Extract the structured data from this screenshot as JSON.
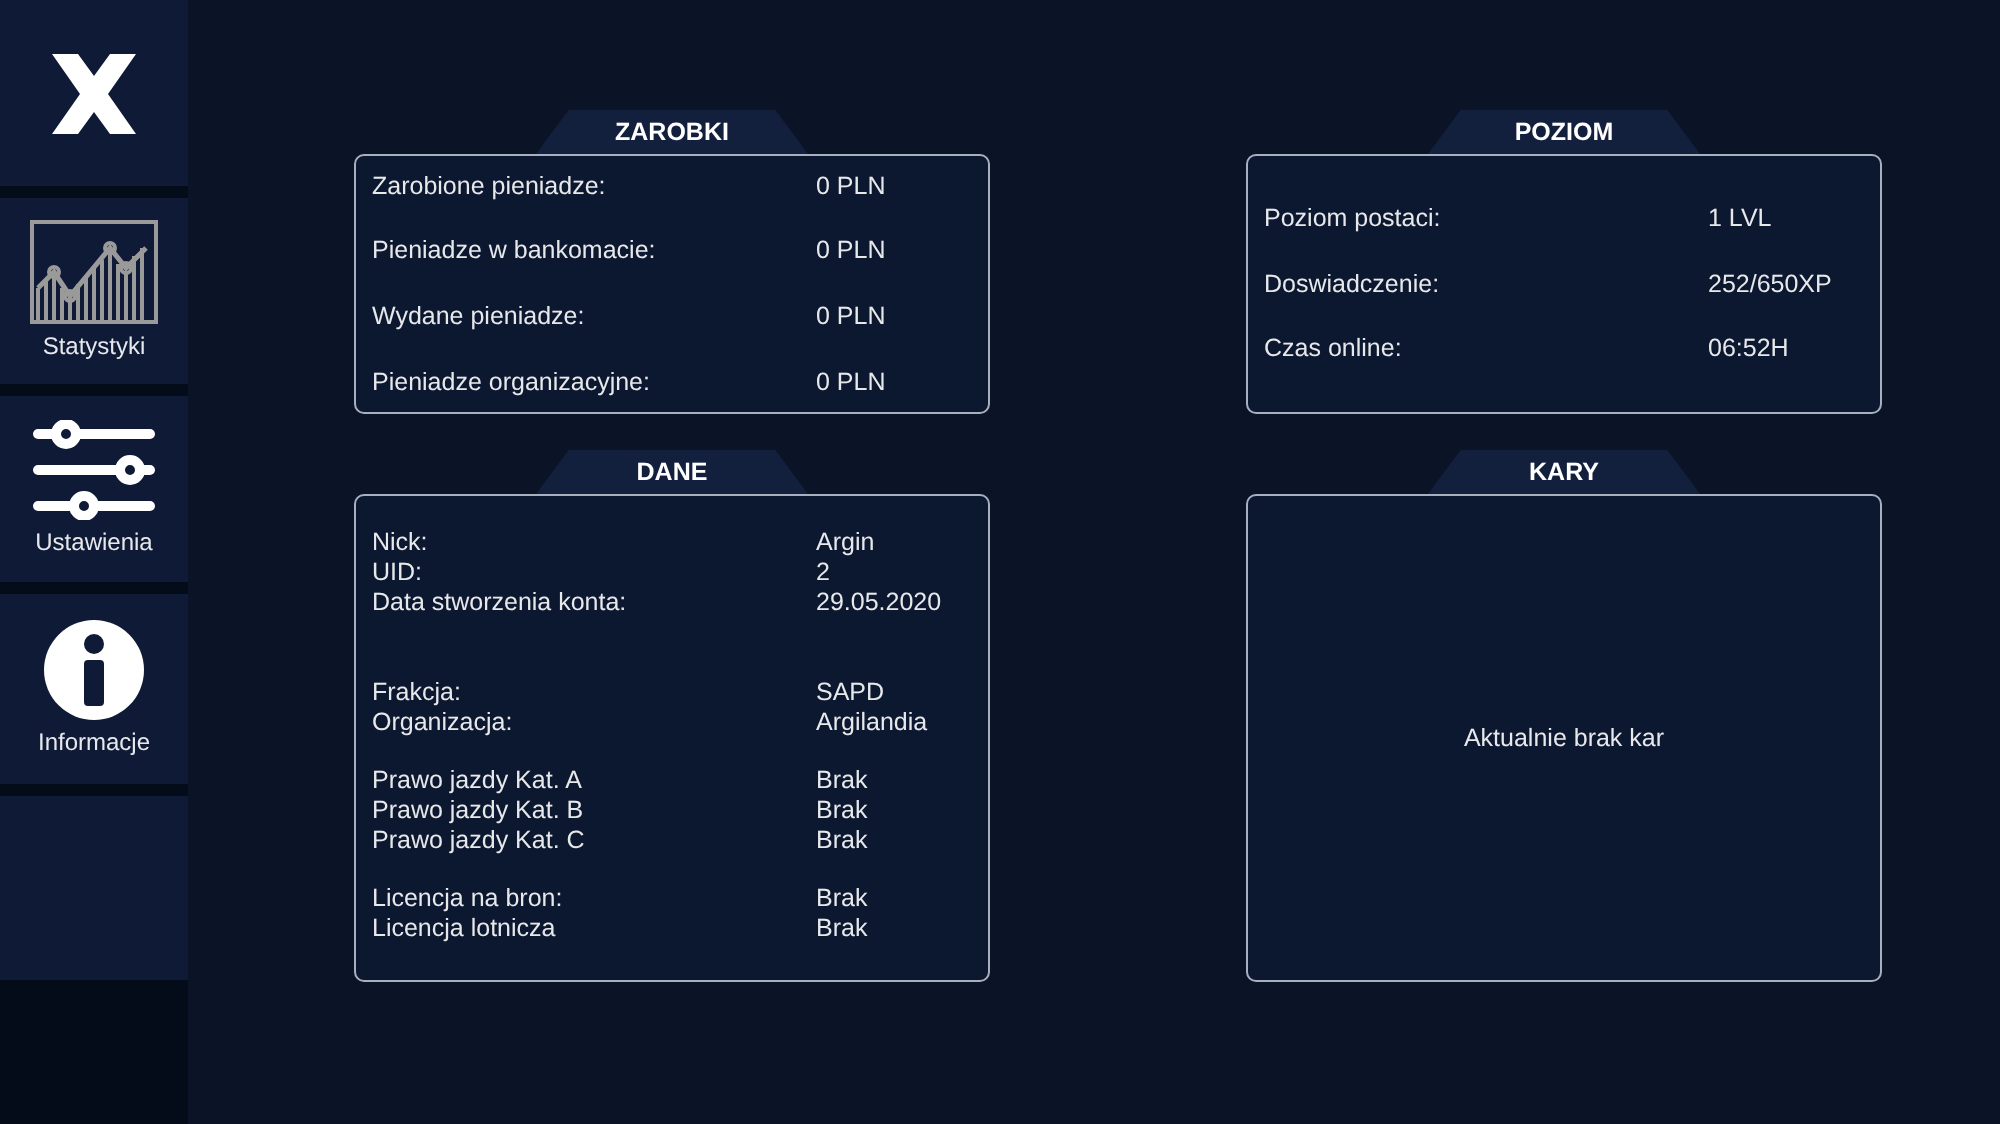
{
  "sidebar": {
    "items": [
      {
        "kind": "close"
      },
      {
        "kind": "stats",
        "label": "Statystyki"
      },
      {
        "kind": "settings",
        "label": "Ustawienia"
      },
      {
        "kind": "info",
        "label": "Informacje"
      }
    ]
  },
  "panels": [
    {
      "title": "ZAROBKI",
      "kind": "list",
      "rows": [
        {
          "label": "Zarobione pieniadze:",
          "value": "0 PLN"
        },
        {
          "label": "Pieniadze w bankomacie:",
          "value": "0 PLN"
        },
        {
          "label": "Wydane pieniadze:",
          "value": "0 PLN"
        },
        {
          "label": "Pieniadze organizacyjne:",
          "value": "0 PLN"
        }
      ]
    },
    {
      "title": "POZIOM",
      "kind": "list",
      "rows": [
        {
          "label": "Poziom postaci:",
          "value": "1 LVL"
        },
        {
          "label": "Doswiadczenie:",
          "value": "252/650XP"
        },
        {
          "label": "Czas online:",
          "value": "06:52H"
        }
      ]
    },
    {
      "title": "DANE",
      "kind": "groups",
      "groups": [
        [
          {
            "label": "Nick:",
            "value": "Argin"
          },
          {
            "label": "UID:",
            "value": "2"
          },
          {
            "label": "Data stworzenia konta:",
            "value": "29.05.2020"
          }
        ],
        [
          {
            "label": "Frakcja:",
            "value": "SAPD"
          },
          {
            "label": "Organizacja:",
            "value": "Argilandia"
          }
        ],
        [
          {
            "label": "Prawo jazdy Kat. A",
            "value": "Brak"
          },
          {
            "label": "Prawo jazdy Kat. B",
            "value": "Brak"
          },
          {
            "label": "Prawo jazdy Kat. C",
            "value": "Brak"
          }
        ],
        [
          {
            "label": "Licencja na bron:",
            "value": "Brak"
          },
          {
            "label": "Licencja lotnicza",
            "value": "Brak"
          }
        ]
      ]
    },
    {
      "title": "KARY",
      "kind": "message",
      "message": "Aktualnie brak kar"
    }
  ]
}
